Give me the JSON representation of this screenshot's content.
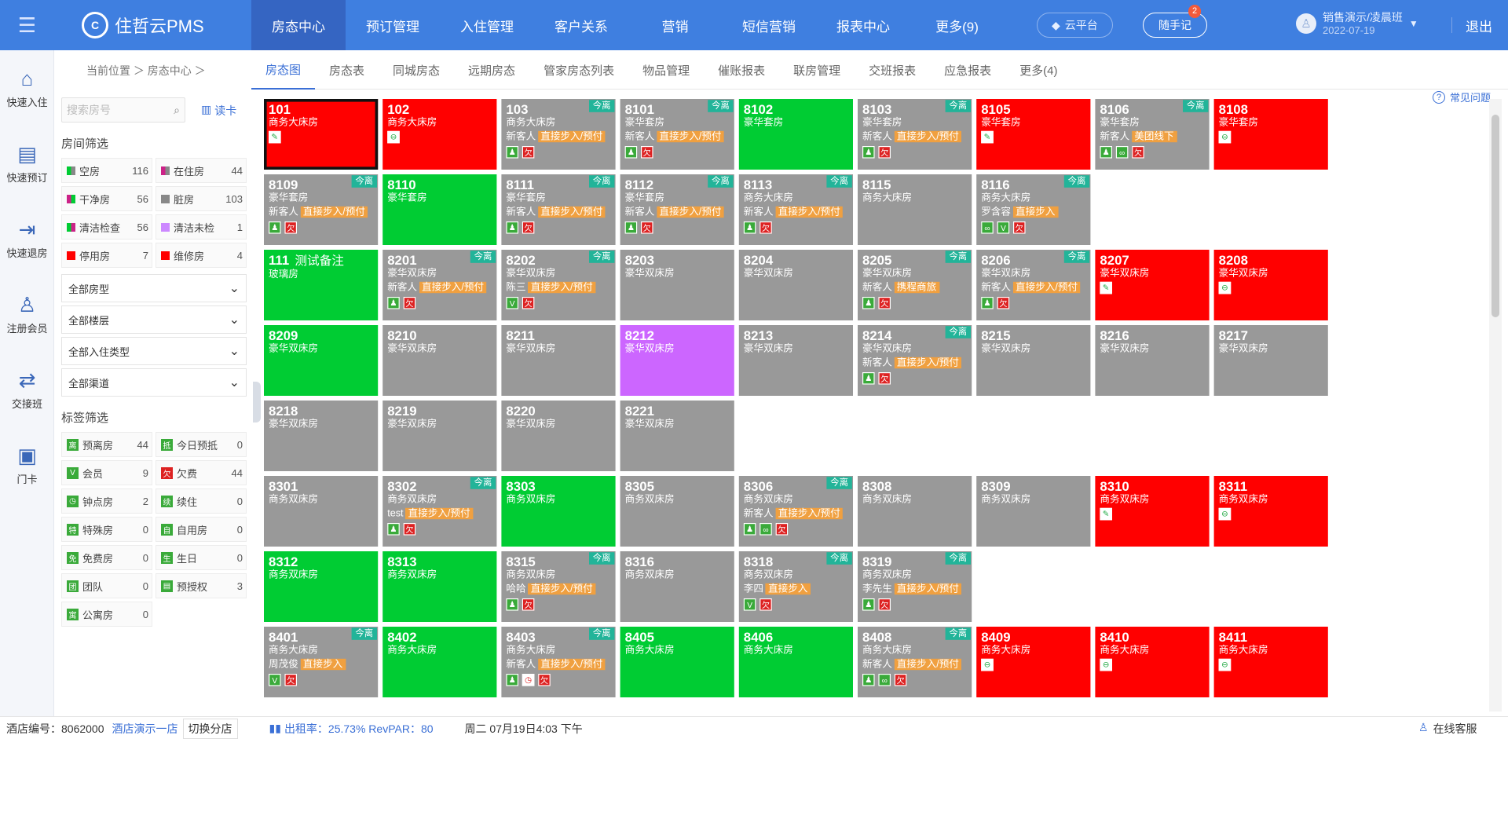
{
  "app": {
    "logo": "住哲云PMS",
    "logo_mark": "C"
  },
  "topnav": [
    "房态中心",
    "预订管理",
    "入住管理",
    "客户关系",
    "营销",
    "短信营销",
    "报表中心",
    "更多(9)"
  ],
  "topbar": {
    "cloud": "云平台",
    "note": "随手记",
    "note_badge": "2",
    "user": "销售演示/凌晨班",
    "date": "2022-07-19",
    "logout": "退出"
  },
  "leftbar": [
    {
      "icon": "home-icon",
      "glyph": "⌂",
      "label": "快速入住"
    },
    {
      "icon": "booking-icon",
      "glyph": "▤",
      "label": "快速预订"
    },
    {
      "icon": "checkout-icon",
      "glyph": "⇥",
      "label": "快速退房"
    },
    {
      "icon": "member-icon",
      "glyph": "♙",
      "label": "注册会员"
    },
    {
      "icon": "shift-icon",
      "glyph": "⇄",
      "label": "交接班"
    },
    {
      "icon": "doorcard-icon",
      "glyph": "▣",
      "label": "门卡"
    }
  ],
  "breadcrumb": "当前位置 ＞ 房态中心 ＞",
  "subnav": [
    "房态图",
    "房态表",
    "同城房态",
    "远期房态",
    "管家房态列表",
    "物品管理",
    "催账报表",
    "联房管理",
    "交班报表",
    "应急报表",
    "更多(4)"
  ],
  "help": "常见问题",
  "filter": {
    "search_placeholder": "搜索房号",
    "read_card": "读卡",
    "room_filter_title": "房间筛选",
    "room_filters": [
      {
        "label": "空房",
        "count": "116",
        "c1": "#00cc33",
        "c2": "#888"
      },
      {
        "label": "在住房",
        "count": "44",
        "c1": "#cc2288",
        "c2": "#888"
      },
      {
        "label": "干净房",
        "count": "56",
        "c1": "#cc2288",
        "c2": "#00cc33"
      },
      {
        "label": "脏房",
        "count": "103",
        "c1": "#888",
        "c2": "#888"
      },
      {
        "label": "清洁检查",
        "count": "56",
        "c1": "#00cc33",
        "c2": "#cc2288"
      },
      {
        "label": "清洁未检",
        "count": "1",
        "c1": "#cc88ff",
        "c2": "#cc88ff"
      },
      {
        "label": "停用房",
        "count": "7",
        "c1": "#ff0000",
        "c2": "#ff0000"
      },
      {
        "label": "维修房",
        "count": "4",
        "c1": "#ff0000",
        "c2": "#ff0000"
      }
    ],
    "selects": [
      "全部房型",
      "全部楼层",
      "全部入住类型",
      "全部渠道"
    ],
    "tag_filter_title": "标签筛选",
    "tags": [
      {
        "label": "预离房",
        "count": "44",
        "glyph": "离"
      },
      {
        "label": "今日预抵",
        "count": "0",
        "glyph": "抵"
      },
      {
        "label": "会员",
        "count": "9",
        "glyph": "V"
      },
      {
        "label": "欠费",
        "count": "44",
        "glyph": "欠"
      },
      {
        "label": "钟点房",
        "count": "2",
        "glyph": "◷"
      },
      {
        "label": "续住",
        "count": "0",
        "glyph": "续"
      },
      {
        "label": "特殊房",
        "count": "0",
        "glyph": "特"
      },
      {
        "label": "自用房",
        "count": "0",
        "glyph": "自"
      },
      {
        "label": "免费房",
        "count": "0",
        "glyph": "免"
      },
      {
        "label": "生日",
        "count": "0",
        "glyph": "生"
      },
      {
        "label": "团队",
        "count": "0",
        "glyph": "团"
      },
      {
        "label": "预授权",
        "count": "3",
        "glyph": "▤"
      },
      {
        "label": "公寓房",
        "count": "0",
        "glyph": "寓"
      }
    ]
  },
  "rooms": [
    {
      "no": "101",
      "type": "商务大床房",
      "color": "red",
      "sel": true,
      "icons": [
        "wrench"
      ]
    },
    {
      "no": "102",
      "type": "商务大床房",
      "color": "red",
      "icons": [
        "stop"
      ]
    },
    {
      "no": "103",
      "type": "商务大床房",
      "color": "gray",
      "tag": "今离",
      "guest": "新客人",
      "src": "直接步入/预付",
      "icons": [
        "person",
        "owe"
      ]
    },
    {
      "no": "8101",
      "type": "豪华套房",
      "color": "gray",
      "tag": "今离",
      "guest": "新客人",
      "src": "直接步入/预付",
      "icons": [
        "person",
        "owe"
      ]
    },
    {
      "no": "8102",
      "type": "豪华套房",
      "color": "green"
    },
    {
      "no": "8103",
      "type": "豪华套房",
      "color": "gray",
      "tag": "今离",
      "guest": "新客人",
      "src": "直接步入/预付",
      "icons": [
        "person",
        "owe"
      ]
    },
    {
      "no": "8105",
      "type": "豪华套房",
      "color": "red",
      "icons": [
        "wrench"
      ]
    },
    {
      "no": "8106",
      "type": "豪华套房",
      "color": "gray",
      "tag": "今离",
      "guest": "新客人",
      "src": "美团线下",
      "icons": [
        "person",
        "link",
        "owe"
      ]
    },
    {
      "no": "8108",
      "type": "豪华套房",
      "color": "red",
      "icons": [
        "stop"
      ]
    },
    {
      "no": "8109",
      "type": "豪华套房",
      "color": "gray",
      "tag": "今离",
      "guest": "新客人",
      "src": "直接步入/预付",
      "icons": [
        "person",
        "owe"
      ]
    },
    {
      "no": "8110",
      "type": "豪华套房",
      "color": "green"
    },
    {
      "no": "8111",
      "type": "豪华套房",
      "color": "gray",
      "tag": "今离",
      "guest": "新客人",
      "src": "直接步入/预付",
      "icons": [
        "person",
        "owe"
      ]
    },
    {
      "no": "8112",
      "type": "豪华套房",
      "color": "gray",
      "tag": "今离",
      "guest": "新客人",
      "src": "直接步入/预付",
      "icons": [
        "person",
        "owe"
      ]
    },
    {
      "no": "8113",
      "type": "商务大床房",
      "color": "gray",
      "tag": "今离",
      "guest": "新客人",
      "src": "直接步入/预付",
      "icons": [
        "person",
        "owe"
      ]
    },
    {
      "no": "8115",
      "type": "商务大床房",
      "color": "gray"
    },
    {
      "no": "8116",
      "type": "商务大床房",
      "color": "gray",
      "tag": "今离",
      "guest": "罗含容",
      "src": "直接步入",
      "icons": [
        "link",
        "vip",
        "owe"
      ]
    },
    {
      "no": "111",
      "remark": "测试备注",
      "type": "玻璃房",
      "color": "green"
    },
    {
      "no": "8201",
      "type": "豪华双床房",
      "color": "gray",
      "tag": "今离",
      "guest": "新客人",
      "src": "直接步入/预付",
      "icons": [
        "person",
        "owe"
      ]
    },
    {
      "no": "8202",
      "type": "豪华双床房",
      "color": "gray",
      "tag": "今离",
      "guest": "陈三",
      "src": "直接步入/预付",
      "icons": [
        "vip",
        "owe"
      ]
    },
    {
      "no": "8203",
      "type": "豪华双床房",
      "color": "gray"
    },
    {
      "no": "8204",
      "type": "豪华双床房",
      "color": "gray"
    },
    {
      "no": "8205",
      "type": "豪华双床房",
      "color": "gray",
      "tag": "今离",
      "guest": "新客人",
      "src": "携程商旅",
      "icons": [
        "person",
        "owe"
      ]
    },
    {
      "no": "8206",
      "type": "豪华双床房",
      "color": "gray",
      "tag": "今离",
      "guest": "新客人",
      "src": "直接步入/预付",
      "icons": [
        "person",
        "owe"
      ]
    },
    {
      "no": "8207",
      "type": "豪华双床房",
      "color": "red",
      "icons": [
        "wrench"
      ]
    },
    {
      "no": "8208",
      "type": "豪华双床房",
      "color": "red",
      "icons": [
        "stop"
      ]
    },
    {
      "no": "8209",
      "type": "豪华双床房",
      "color": "green"
    },
    {
      "no": "8210",
      "type": "豪华双床房",
      "color": "gray"
    },
    {
      "no": "8211",
      "type": "豪华双床房",
      "color": "gray"
    },
    {
      "no": "8212",
      "type": "豪华双床房",
      "color": "purple"
    },
    {
      "no": "8213",
      "type": "豪华双床房",
      "color": "gray"
    },
    {
      "no": "8214",
      "type": "豪华双床房",
      "color": "gray",
      "tag": "今离",
      "guest": "新客人",
      "src": "直接步入/预付",
      "icons": [
        "person",
        "owe"
      ]
    },
    {
      "no": "8215",
      "type": "豪华双床房",
      "color": "gray"
    },
    {
      "no": "8216",
      "type": "豪华双床房",
      "color": "gray"
    },
    {
      "no": "8217",
      "type": "豪华双床房",
      "color": "gray"
    },
    {
      "no": "8218",
      "type": "豪华双床房",
      "color": "gray"
    },
    {
      "no": "8219",
      "type": "豪华双床房",
      "color": "gray"
    },
    {
      "no": "8220",
      "type": "豪华双床房",
      "color": "gray"
    },
    {
      "no": "8221",
      "type": "豪华双床房",
      "color": "gray"
    },
    {
      "no": "8301",
      "type": "商务双床房",
      "color": "gray"
    },
    {
      "no": "8302",
      "type": "商务双床房",
      "color": "gray",
      "tag": "今离",
      "guest": "test",
      "src": "直接步入/预付",
      "icons": [
        "person",
        "owe"
      ]
    },
    {
      "no": "8303",
      "type": "商务双床房",
      "color": "green"
    },
    {
      "no": "8305",
      "type": "商务双床房",
      "color": "gray"
    },
    {
      "no": "8306",
      "type": "商务双床房",
      "color": "gray",
      "tag": "今离",
      "guest": "新客人",
      "src": "直接步入/预付",
      "icons": [
        "person",
        "link",
        "owe"
      ]
    },
    {
      "no": "8308",
      "type": "商务双床房",
      "color": "gray"
    },
    {
      "no": "8309",
      "type": "商务双床房",
      "color": "gray"
    },
    {
      "no": "8310",
      "type": "商务双床房",
      "color": "red",
      "icons": [
        "wrench"
      ]
    },
    {
      "no": "8311",
      "type": "商务双床房",
      "color": "red",
      "icons": [
        "stop"
      ]
    },
    {
      "no": "8312",
      "type": "商务双床房",
      "color": "green"
    },
    {
      "no": "8313",
      "type": "商务双床房",
      "color": "green"
    },
    {
      "no": "8315",
      "type": "商务双床房",
      "color": "gray",
      "tag": "今离",
      "guest": "哈哈",
      "src": "直接步入/预付",
      "icons": [
        "person",
        "owe"
      ]
    },
    {
      "no": "8316",
      "type": "商务双床房",
      "color": "gray"
    },
    {
      "no": "8318",
      "type": "商务双床房",
      "color": "gray",
      "tag": "今离",
      "guest": "李四",
      "src": "直接步入",
      "icons": [
        "vip",
        "owe"
      ]
    },
    {
      "no": "8319",
      "type": "商务双床房",
      "color": "gray",
      "tag": "今离",
      "guest": "李先生",
      "src": "直接步入/预付",
      "icons": [
        "person",
        "owe"
      ]
    },
    {
      "no": "8401",
      "type": "商务大床房",
      "color": "gray",
      "tag": "今离",
      "guest": "周茂俊",
      "src": "直接步入",
      "icons": [
        "vip",
        "owe"
      ]
    },
    {
      "no": "8402",
      "type": "商务大床房",
      "color": "green"
    },
    {
      "no": "8403",
      "type": "商务大床房",
      "color": "gray",
      "tag": "今离",
      "guest": "新客人",
      "src": "直接步入/预付",
      "icons": [
        "person",
        "clock",
        "owe"
      ]
    },
    {
      "no": "8405",
      "type": "商务大床房",
      "color": "green"
    },
    {
      "no": "8406",
      "type": "商务大床房",
      "color": "green"
    },
    {
      "no": "8408",
      "type": "商务大床房",
      "color": "gray",
      "tag": "今离",
      "guest": "新客人",
      "src": "直接步入/预付",
      "icons": [
        "person",
        "link",
        "owe"
      ]
    },
    {
      "no": "8409",
      "type": "商务大床房",
      "color": "red",
      "icons": [
        "stop"
      ]
    },
    {
      "no": "8410",
      "type": "商务大床房",
      "color": "red",
      "icons": [
        "stop"
      ]
    },
    {
      "no": "8411",
      "type": "商务大床房",
      "color": "red",
      "icons": [
        "stop"
      ]
    }
  ],
  "icon_glyphs": {
    "wrench": "✎",
    "stop": "⊖",
    "person": "♟",
    "owe": "欠",
    "link": "∞",
    "vip": "V",
    "clock": "◷"
  },
  "status": {
    "hotel_label": "酒店编号：",
    "hotel_no": "8062000",
    "hotel_name": "酒店演示一店",
    "switch": "切换分店",
    "occupancy": "出租率：25.73% RevPAR：80",
    "datetime": "周二 07月19日4:03 下午",
    "service": "在线客服"
  }
}
